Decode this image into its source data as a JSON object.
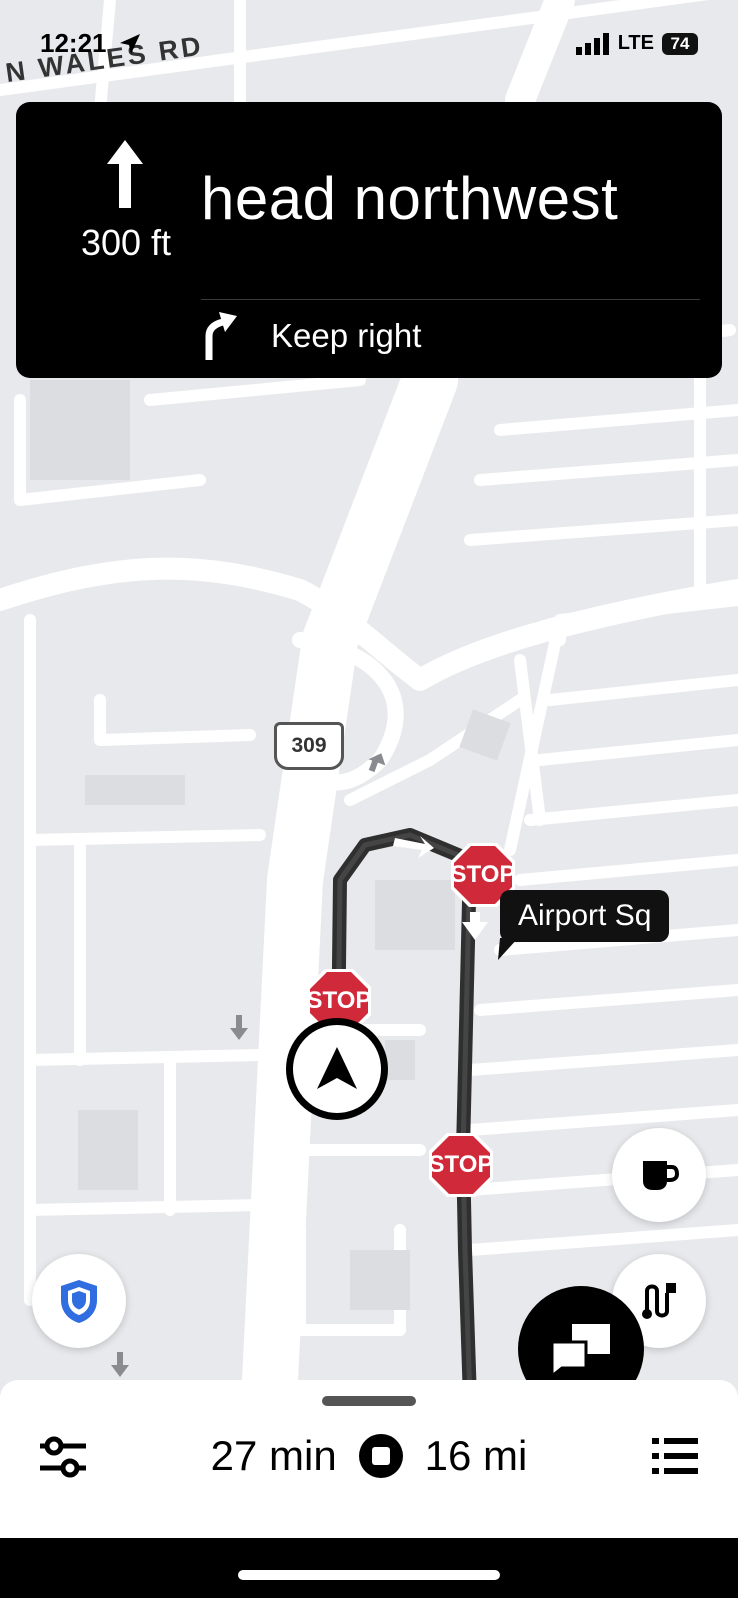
{
  "status_bar": {
    "time": "12:21",
    "network": "LTE",
    "battery": "74"
  },
  "map": {
    "street_label": "N WALES RD",
    "route_shield": "309",
    "stop_sign_label": "STOP",
    "place_callout": "Airport Sq"
  },
  "navigation": {
    "distance": "300 ft",
    "instruction": "head northwest",
    "next_instruction": "Keep right"
  },
  "trip": {
    "duration": "27 min",
    "distance": "16 mi"
  },
  "icons": {
    "location": "location-arrow-icon",
    "shield": "safety-shield-icon",
    "coffee": "coffee-cup-icon",
    "route": "route-icon",
    "chat": "chat-icon",
    "settings": "sliders-icon",
    "stop": "stop-icon",
    "list": "list-icon"
  },
  "colors": {
    "route": "#2f2f2f",
    "stop_sign": "#d0293a",
    "shield_blue": "#2f6de0"
  }
}
